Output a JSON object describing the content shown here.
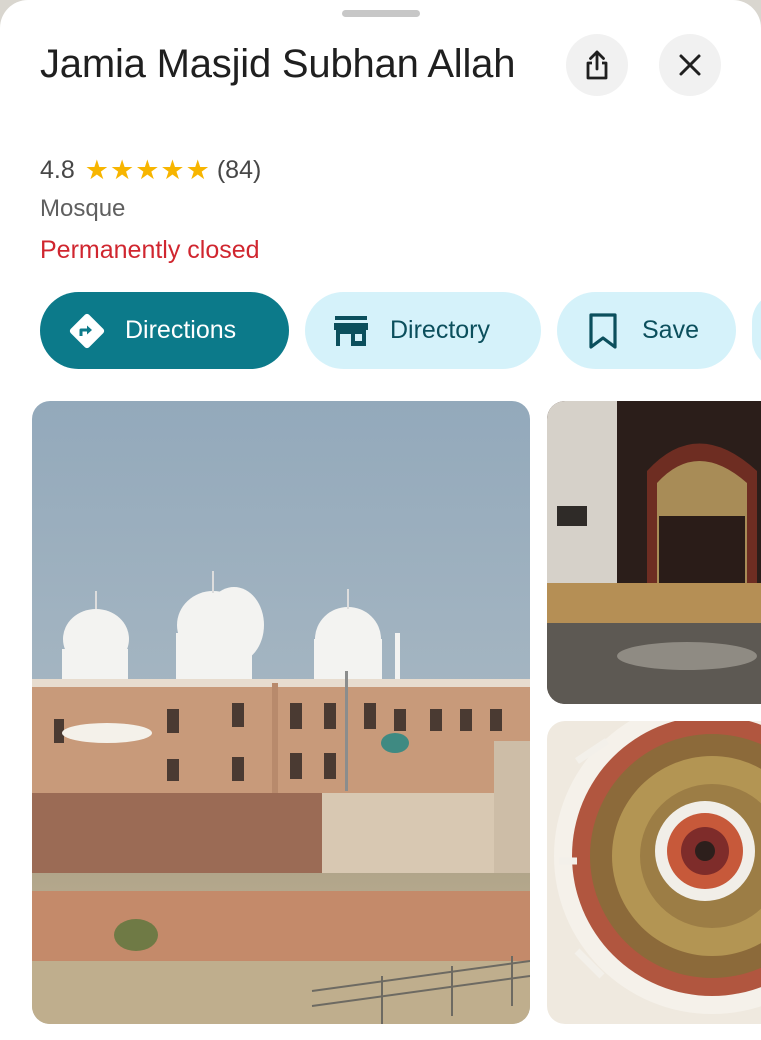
{
  "place": {
    "title": "Jamia Masjid Subhan Allah",
    "rating": "4.8",
    "stars_shown": 5,
    "review_count": "(84)",
    "category": "Mosque",
    "status": "Permanently closed"
  },
  "actions": {
    "directions_label": "Directions",
    "directory_label": "Directory",
    "save_label": "Save"
  },
  "icons": {
    "share": "share-icon",
    "close": "close-icon",
    "directions": "directions-diamond-icon",
    "directory": "storefront-icon",
    "save": "bookmark-icon"
  },
  "colors": {
    "primary_chip": "#0c7a8a",
    "secondary_chip": "#d5f2fa",
    "status_closed": "#d0262f",
    "star": "#f7b500"
  }
}
